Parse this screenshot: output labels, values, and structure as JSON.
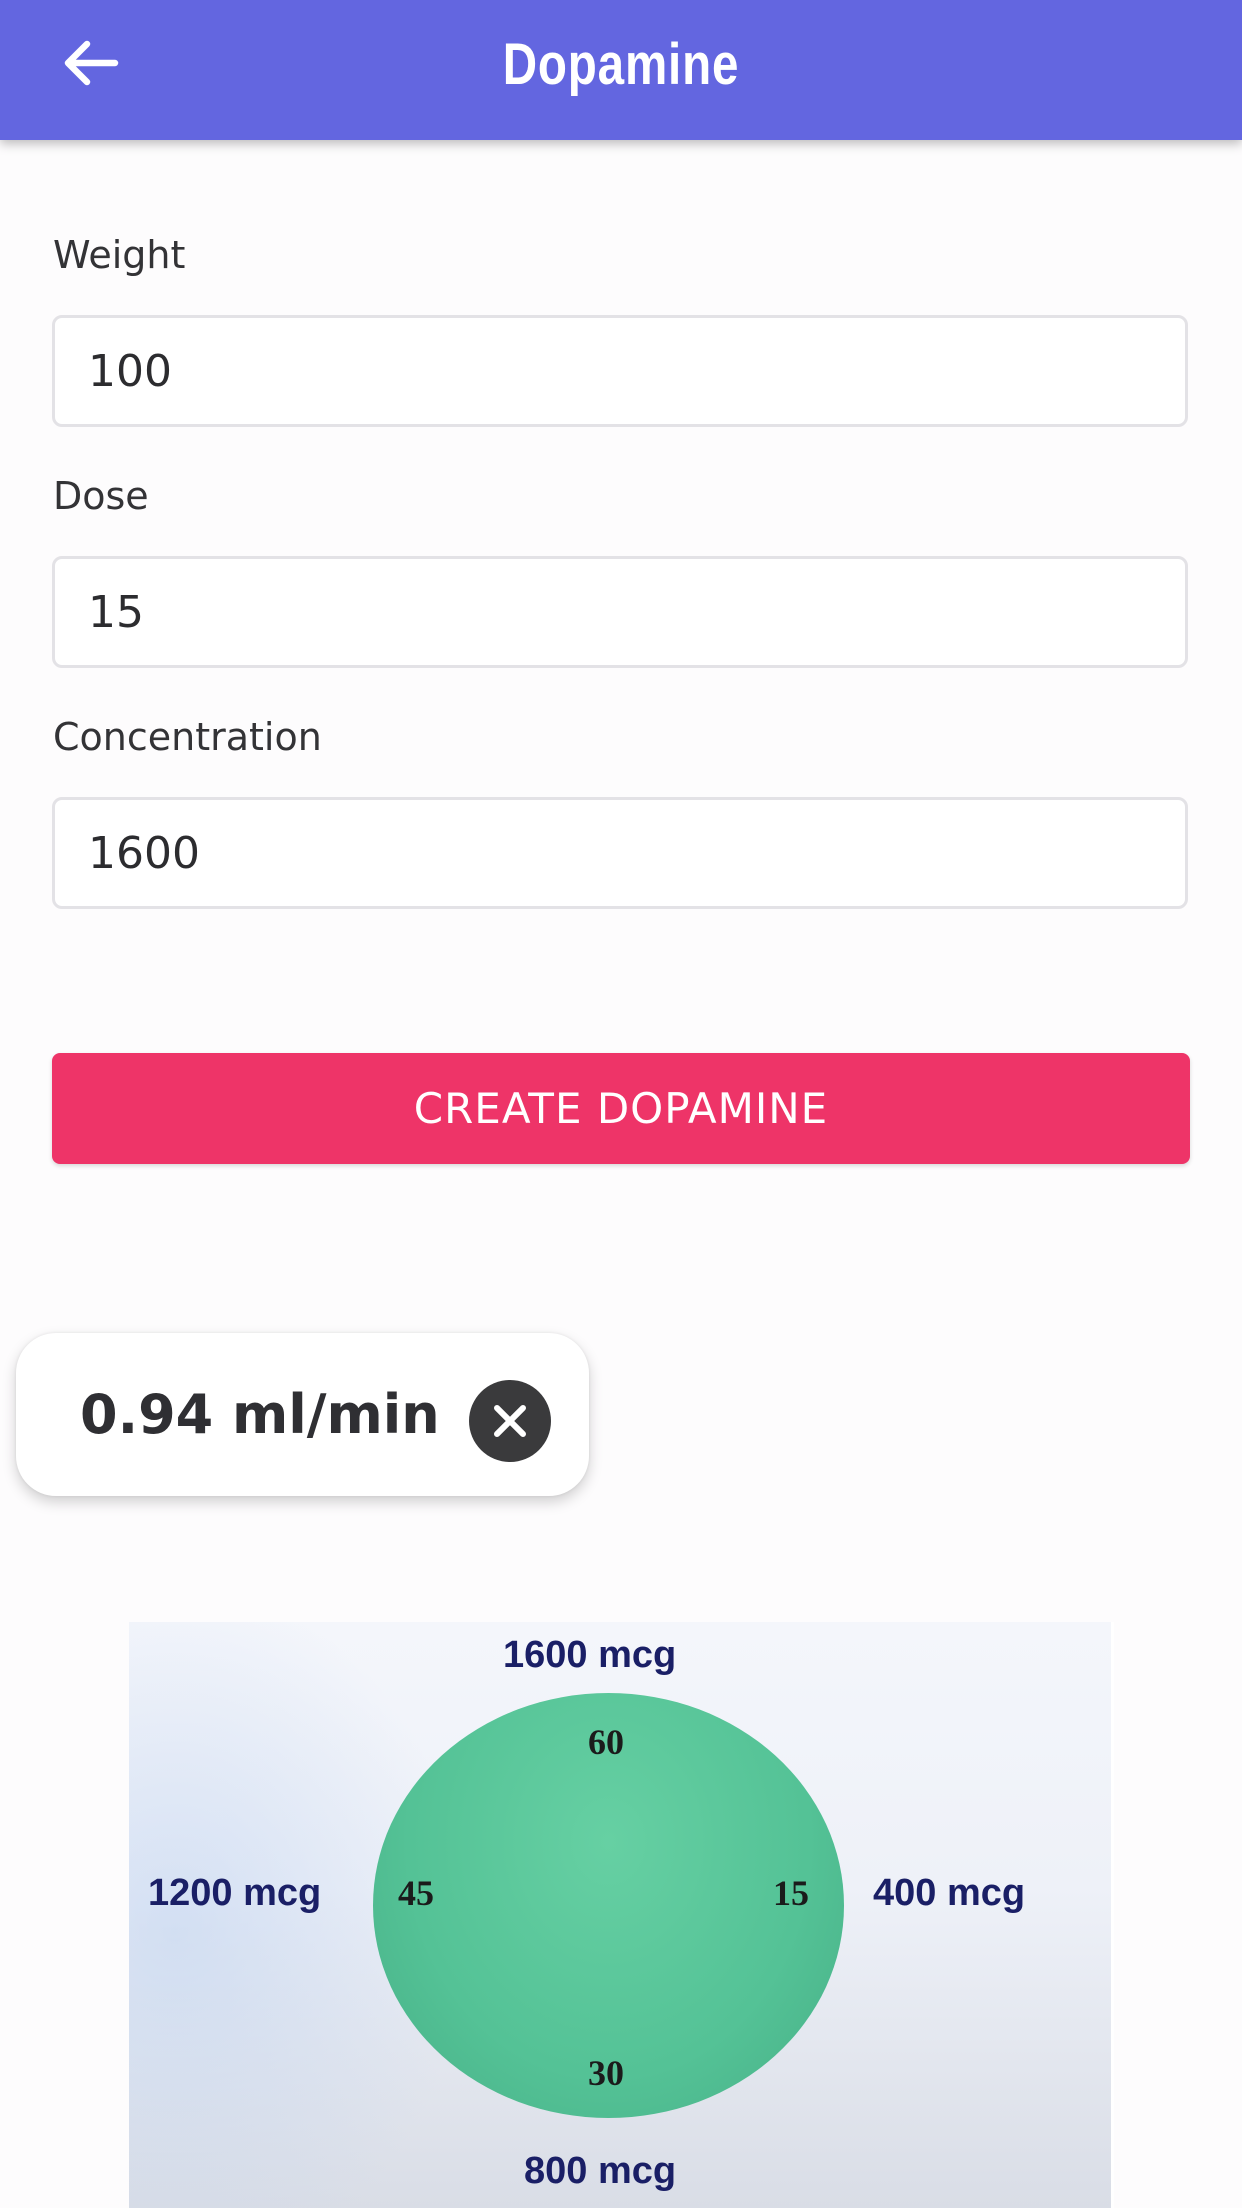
{
  "header": {
    "title": "Dopamine",
    "back_icon": "arrow-left-icon"
  },
  "form": {
    "fields": [
      {
        "label": "Weight",
        "value": "100"
      },
      {
        "label": "Dose",
        "value": "15"
      },
      {
        "label": "Concentration",
        "value": "1600"
      }
    ],
    "submit_label": "CREATE DOPAMINE"
  },
  "result": {
    "value": "0.94 ml/min",
    "close_icon": "close-circle-icon"
  },
  "diagram": {
    "outer_labels": {
      "top": "1600 mcg",
      "left": "1200 mcg",
      "right": "400 mcg",
      "bottom": "800 mcg"
    },
    "inner_labels": {
      "top": "60",
      "left": "45",
      "right": "15",
      "bottom": "30"
    }
  },
  "colors": {
    "appbar": "#6366e0",
    "button": "#ee3468",
    "circle": "#54c296",
    "diagram_text": "#1a1f66"
  }
}
